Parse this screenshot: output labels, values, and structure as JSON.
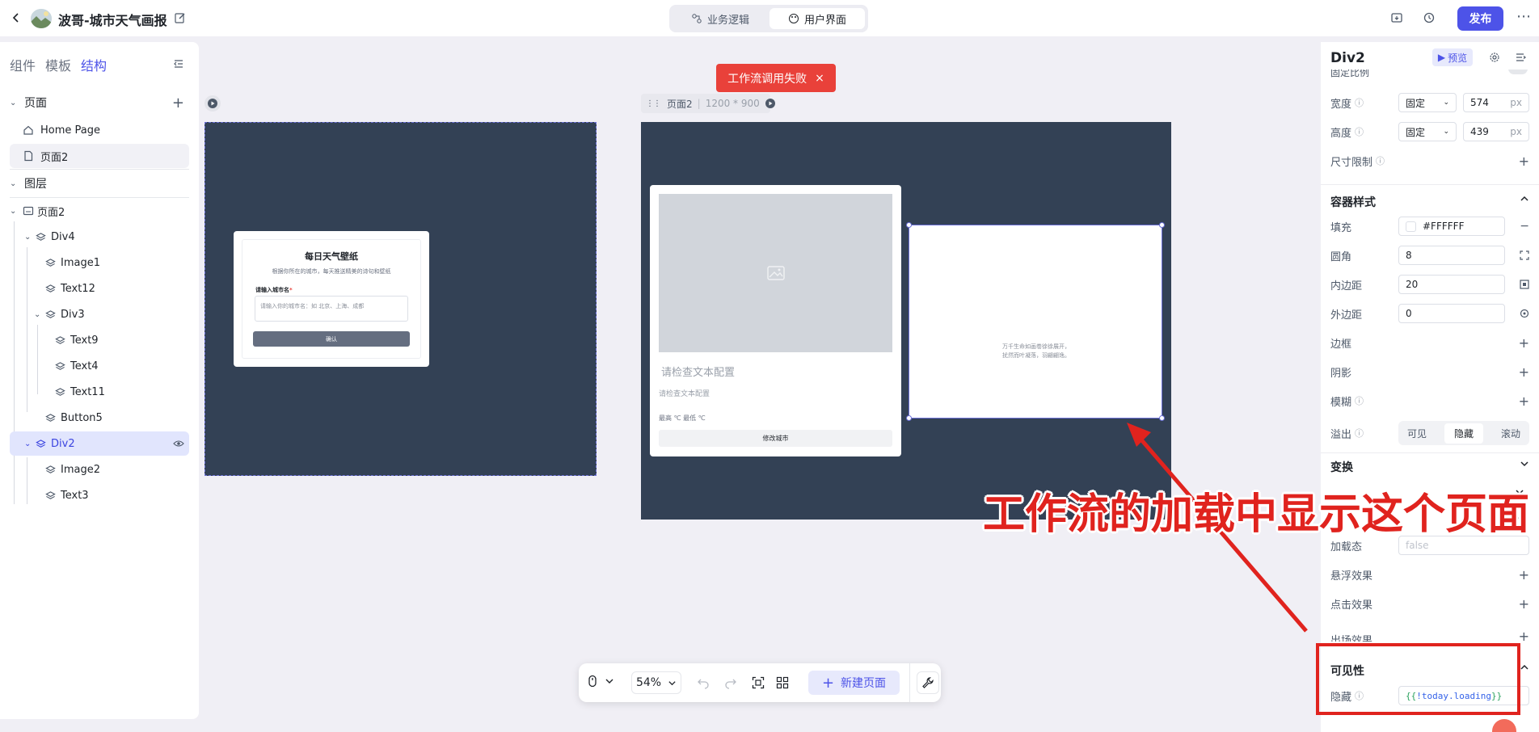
{
  "app": {
    "title": "波哥-城市天气画报",
    "tabs": [
      {
        "label": "业务逻辑",
        "icon": "workflow-icon"
      },
      {
        "label": "用户界面",
        "icon": "palette-icon",
        "active": true
      }
    ],
    "publish_label": "发布"
  },
  "left_panel": {
    "tabs": [
      "组件",
      "模板",
      "结构"
    ],
    "active_tab": "结构",
    "pages_section": "页面",
    "pages": [
      "Home Page",
      "页面2"
    ],
    "layers_section": "图层",
    "layers": [
      {
        "label": "页面2",
        "icon": "page-icon"
      },
      {
        "label": "Div4"
      },
      {
        "label": "Image1"
      },
      {
        "label": "Text12"
      },
      {
        "label": "Div3"
      },
      {
        "label": "Text9"
      },
      {
        "label": "Text4"
      },
      {
        "label": "Text11"
      },
      {
        "label": "Button5"
      },
      {
        "label": "Div2",
        "selected": true
      },
      {
        "label": "Image2"
      },
      {
        "label": "Text3"
      }
    ]
  },
  "canvas": {
    "toast": "工作流调用失败",
    "page_label": "页面2",
    "page_size": "1200 * 900",
    "card1": {
      "title": "每日天气壁纸",
      "subtitle": "根据你所在的城市，每天推送精美的诗句和壁纸",
      "field_label": "请输入城市名",
      "field_placeholder": "请输入你的城市名：如 北京、上海、成都",
      "button": "确认"
    },
    "card2": {
      "text_large": "请检查文本配置",
      "text_small": "请检查文本配置",
      "temps": "最高 ℃  最低 ℃",
      "button": "修改城市"
    },
    "loading_card": {
      "line1": "万千生命如画卷徐徐展开，",
      "line2": "扰然而叶凝落，羽翩翩逸。"
    },
    "annotation": "工作流的加载中显示这个页面"
  },
  "toolbar": {
    "zoom": "54%",
    "new_page": "新建页面"
  },
  "right_panel": {
    "title": "Div2",
    "preview_label": "预览",
    "partial_top": "固定比例",
    "width_label": "宽度",
    "width_mode": "固定",
    "width_value": "574",
    "height_label": "高度",
    "height_mode": "固定",
    "height_value": "439",
    "unit": "px",
    "size_limit": "尺寸限制",
    "container_section": "容器样式",
    "fill_label": "填充",
    "fill_value": "#FFFFFF",
    "radius_label": "圆角",
    "radius_value": "8",
    "padding_label": "内边距",
    "padding_value": "20",
    "margin_label": "外边距",
    "margin_value": "0",
    "border_label": "边框",
    "shadow_label": "阴影",
    "blur_label": "模糊",
    "overflow_label": "溢出",
    "overflow_options": [
      "可见",
      "隐藏",
      "滚动"
    ],
    "overflow_selected": "隐藏",
    "transform_section": "变换",
    "loading_label": "加载态",
    "loading_placeholder": "false",
    "hover_label": "悬浮效果",
    "click_label": "点击效果",
    "enter_label": "出场效果",
    "visibility_section": "可见性",
    "hide_label": "隐藏",
    "hide_expr_open": "{{ ",
    "hide_expr_var": "!today.loading",
    "hide_expr_close": " }}"
  },
  "colors": {
    "accent": "#4d53e8",
    "canvas_page": "#334155",
    "toast": "#e9413a",
    "annotation": "#e0231e"
  }
}
